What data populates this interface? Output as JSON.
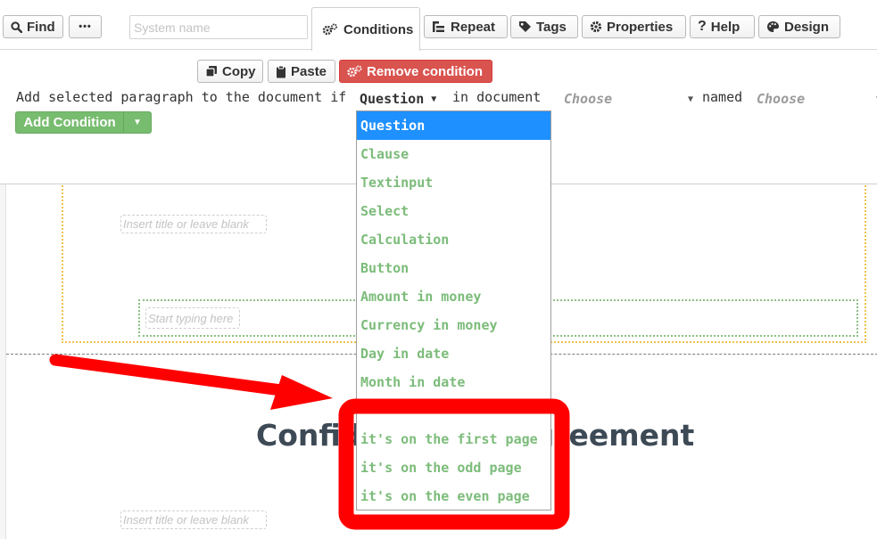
{
  "toolbar": {
    "find_label": "Find",
    "more_label": "•••",
    "system_name_placeholder": "System name",
    "conditions_tab_label": "Conditions",
    "repeat_label": "Repeat",
    "tags_label": "Tags",
    "properties_label": "Properties",
    "help_label": "Help",
    "design_label": "Design"
  },
  "condition_panel": {
    "copy_label": "Copy",
    "paste_label": "Paste",
    "remove_label": "Remove condition",
    "sentence_prefix": "Add selected paragraph to the document if",
    "type_selected": "Question",
    "in_document_label": "in document",
    "document_placeholder": "Choose",
    "named_label": "named",
    "name_placeholder": "Choose",
    "add_condition_label": "Add Condition"
  },
  "dropdown": {
    "options": [
      "Question",
      "Clause",
      "Textinput",
      "Select",
      "Calculation",
      "Button",
      "Amount in money",
      "Currency in money",
      "Day in date",
      "Month in date"
    ],
    "page_options": [
      "it's on the first page",
      "it's on the odd page",
      "it's on the even page"
    ]
  },
  "document": {
    "title_placeholder_1": "Insert title or leave blank",
    "typing_placeholder": "Start typing here",
    "heading": "Confidentiality Agreement",
    "title_placeholder_2": "Insert title or leave blank"
  },
  "colors": {
    "annotation_red": "#ff0000",
    "selected_option": "#1e90ff",
    "option_text": "#7cbc7a",
    "remove_button": "#d9534f",
    "add_button": "#77bc6f"
  }
}
